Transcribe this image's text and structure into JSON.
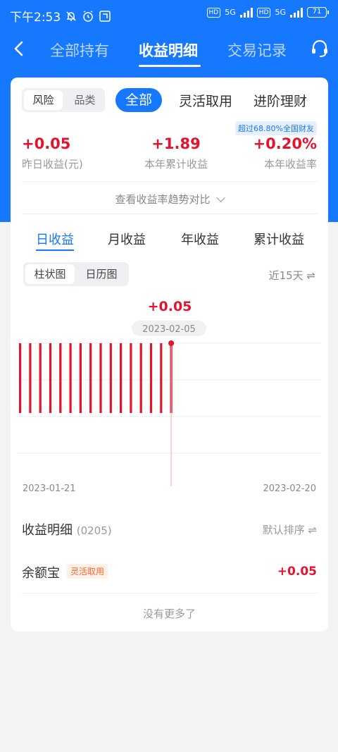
{
  "status_bar": {
    "time": "下午2:53",
    "network": "5G",
    "hd": "HD",
    "battery": "71"
  },
  "nav": {
    "tabs": [
      {
        "label": "全部持有"
      },
      {
        "label": "收益明细"
      },
      {
        "label": "交易记录"
      }
    ]
  },
  "filters": {
    "risk_label": "风险",
    "category_label": "品类",
    "all_label": "全部",
    "flex_label": "灵活取用",
    "advanced_label": "进阶理财"
  },
  "rank_badge": "超过68.80%全国财友",
  "stats": [
    {
      "value": "+0.05",
      "label": "昨日收益(元)"
    },
    {
      "value": "+1.89",
      "label": "本年累计收益"
    },
    {
      "value": "+0.20%",
      "label": "本年收益率"
    }
  ],
  "trend_link": "查看收益率趋势对比",
  "period_tabs": [
    {
      "label": "日收益"
    },
    {
      "label": "月收益"
    },
    {
      "label": "年收益"
    },
    {
      "label": "累计收益"
    }
  ],
  "view_toggle": {
    "bar_label": "柱状图",
    "calendar_label": "日历图"
  },
  "range_label": "近15天 ⇌",
  "chart_data": {
    "type": "bar",
    "x_start": "2023-01-21",
    "x_end": "2023-02-20",
    "selected": {
      "date": "2023-02-05",
      "value": "+0.05"
    },
    "values": [
      0.05,
      0.05,
      0.05,
      0.05,
      0.05,
      0.05,
      0.05,
      0.05,
      0.05,
      0.05,
      0.05,
      0.05,
      0.05,
      0.05,
      0.05,
      0.05
    ],
    "colors": {
      "bar": "#e5132d",
      "grid": "#eeeeee"
    }
  },
  "detail": {
    "title": "收益明细",
    "code": "(0205)",
    "sort_label": "默认排序 ⇌",
    "rows": [
      {
        "name": "余额宝",
        "tag": "灵活取用",
        "value": "+0.05"
      }
    ],
    "no_more": "没有更多了"
  }
}
